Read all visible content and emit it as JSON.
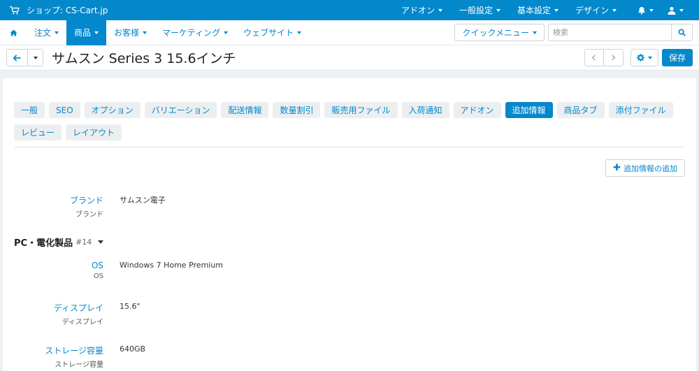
{
  "topbar": {
    "store_label": "ショップ: CS-Cart.jp",
    "menus": [
      "アドオン",
      "一般設定",
      "基本設定",
      "デザイン"
    ]
  },
  "navbar": {
    "items": [
      "注文",
      "商品",
      "お客様",
      "マーケティング",
      "ウェブサイト"
    ],
    "active": "商品",
    "quick_menu": "クイックメニュー",
    "search_placeholder": "検索"
  },
  "titlebar": {
    "title": "サムスン Series 3 15.6インチ",
    "save_label": "保存"
  },
  "tabs": [
    "一般",
    "SEO",
    "オプション",
    "バリエーション",
    "配送情報",
    "数量割引",
    "販売用ファイル",
    "入荷通知",
    "アドオン",
    "追加情報",
    "商品タブ",
    "添付ファイル",
    "レビュー",
    "レイアウト"
  ],
  "active_tab": "追加情報",
  "add_button_label": "追加情報の追加",
  "features": [
    {
      "label": "ブランド",
      "sub": "ブランド",
      "value": "サムスン電子"
    }
  ],
  "group": {
    "name": "PC・電化製品",
    "id": "#14",
    "features": [
      {
        "label": "OS",
        "sub": "OS",
        "value": "Windows 7 Home Premium"
      },
      {
        "label": "ディスプレイ",
        "sub": "ディスプレイ",
        "value": "15.6\""
      },
      {
        "label": "ストレージ容量",
        "sub": "ストレージ容量",
        "value": "640GB"
      }
    ]
  },
  "colors": {
    "accent": "#0388cc",
    "tab_bg": "#eceef0",
    "page_bg": "#eef1f4"
  }
}
